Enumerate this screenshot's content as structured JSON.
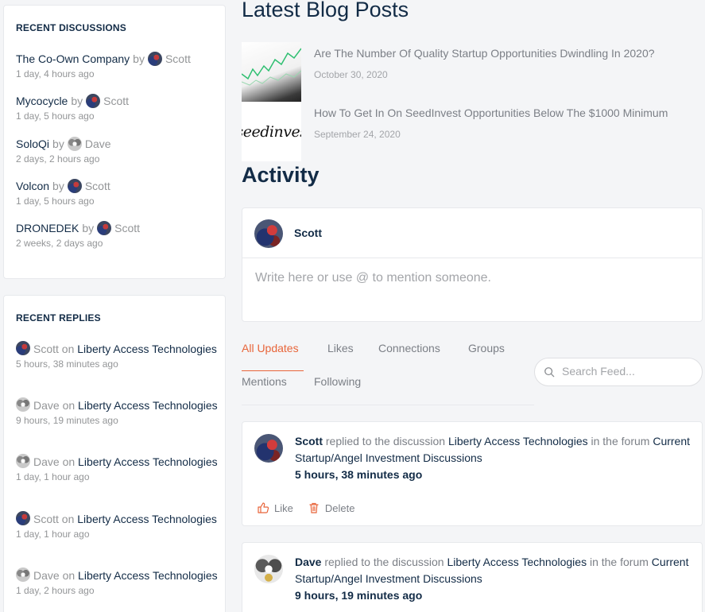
{
  "recent_discussions": {
    "title": "RECENT DISCUSSIONS",
    "by_word": "by",
    "items": [
      {
        "topic": "The Co-Own Company",
        "author": "Scott",
        "avatar": "scott-avatar",
        "time": "1 day, 4 hours ago"
      },
      {
        "topic": "Mycocycle",
        "author": "Scott",
        "avatar": "scott-avatar",
        "time": "1 day, 5 hours ago"
      },
      {
        "topic": "SoloQi",
        "author": "Dave",
        "avatar": "dave-avatar",
        "time": "2 days, 2 hours ago"
      },
      {
        "topic": "Volcon",
        "author": "Scott",
        "avatar": "scott-avatar",
        "time": "1 day, 5 hours ago"
      },
      {
        "topic": "DRONEDEK",
        "author": "Scott",
        "avatar": "scott-avatar",
        "time": "2 weeks, 2 days ago"
      }
    ]
  },
  "recent_replies": {
    "title": "RECENT REPLIES",
    "on_word": "on",
    "items": [
      {
        "author": "Scott",
        "avatar": "scott-avatar",
        "topic": "Liberty Access Technologies",
        "time": "5 hours, 38 minutes ago"
      },
      {
        "author": "Dave",
        "avatar": "dave-avatar",
        "topic": "Liberty Access Technologies",
        "time": "9 hours, 19 minutes ago"
      },
      {
        "author": "Dave",
        "avatar": "dave-avatar",
        "topic": "Liberty Access Technologies",
        "time": "1 day, 1 hour ago"
      },
      {
        "author": "Scott",
        "avatar": "scott-avatar",
        "topic": "Liberty Access Technologies",
        "time": "1 day, 1 hour ago"
      },
      {
        "author": "Dave",
        "avatar": "dave-avatar",
        "topic": "Liberty Access Technologies",
        "time": "1 day, 2 hours ago"
      }
    ]
  },
  "blog": {
    "heading": "Latest Blog Posts",
    "posts": [
      {
        "title": "Are The Number Of Quality Startup Opportunities Dwindling In 2020?",
        "date": "October 30, 2020",
        "thumb": "stock-chart-thumbnail"
      },
      {
        "title": "How To Get In On SeedInvest Opportunities Below The $1000 Minimum",
        "date": "September 24, 2020",
        "thumb": "seedinvest-logo-thumbnail",
        "thumb_text": "seedinves"
      }
    ]
  },
  "activity": {
    "heading": "Activity",
    "composer": {
      "user": "Scott",
      "placeholder": "Write here or use @ to mention someone."
    },
    "tabs": [
      "All Updates",
      "Likes",
      "Connections",
      "Groups",
      "Mentions",
      "Following"
    ],
    "active_tab": "All Updates",
    "search_placeholder": "Search Feed...",
    "feed": [
      {
        "user": "Scott",
        "verb": "replied to the discussion",
        "topic": "Liberty Access Technologies",
        "in_the_forum": "in the forum",
        "forum": "Current Startup/Angel Investment Discussions",
        "time": "5 hours, 38 minutes ago",
        "like_label": "Like",
        "delete_label": "Delete"
      },
      {
        "user": "Dave",
        "verb": "replied to the discussion",
        "topic": "Liberty Access Technologies",
        "in_the_forum": "in the forum",
        "forum": "Current Startup/Angel Investment Discussions",
        "time": "9 hours, 19 minutes ago"
      }
    ]
  },
  "colors": {
    "accent": "#e8653a",
    "text": "#122b46",
    "muted": "#939597"
  }
}
